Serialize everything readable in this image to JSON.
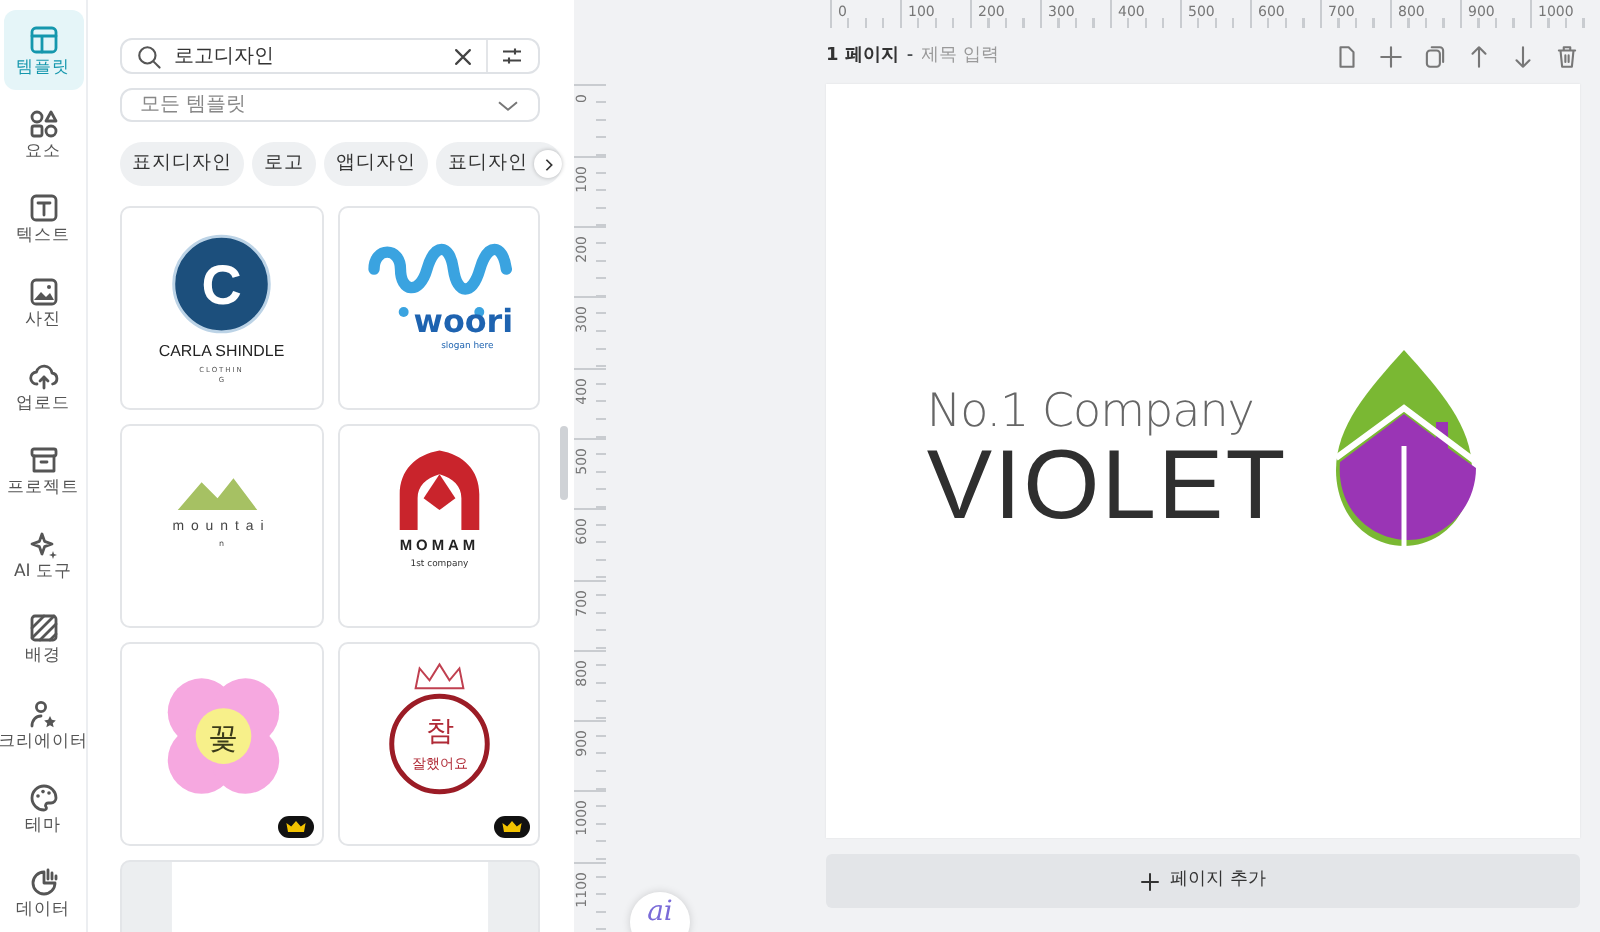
{
  "nav": [
    {
      "kind": "template",
      "label": "템플릿",
      "selected": true
    },
    {
      "kind": "elements",
      "label": "요소",
      "selected": false
    },
    {
      "kind": "text",
      "label": "텍스트",
      "selected": false
    },
    {
      "kind": "photo",
      "label": "사진",
      "selected": false
    },
    {
      "kind": "upload",
      "label": "업로드",
      "selected": false
    },
    {
      "kind": "project",
      "label": "프로젝트",
      "selected": false
    },
    {
      "kind": "sparkle",
      "label": "AI 도구",
      "selected": false
    },
    {
      "kind": "background",
      "label": "배경",
      "selected": false
    },
    {
      "kind": "creator",
      "label": "크리에이터",
      "selected": false
    },
    {
      "kind": "palette",
      "label": "테마",
      "selected": false
    },
    {
      "kind": "data",
      "label": "데이터",
      "selected": false
    }
  ],
  "search": {
    "value": "로고디자인"
  },
  "filter": {
    "value": "모든 템플릿"
  },
  "chips": [
    "표지디자인",
    "로고",
    "앱디자인",
    "표디자인"
  ],
  "templates": [
    {
      "kind": "monogram",
      "texts": [
        "C",
        "CARLA SHINDLE",
        "CLOTHIN",
        "G"
      ],
      "premium": false
    },
    {
      "kind": "wave",
      "texts": [
        "woori",
        "slogan here"
      ],
      "premium": false
    },
    {
      "kind": "mountain",
      "texts": [
        "mountai",
        "n"
      ],
      "premium": false
    },
    {
      "kind": "arch",
      "texts": [
        "MOMAM",
        "1st company"
      ],
      "premium": false
    },
    {
      "kind": "flower",
      "texts": [
        "꽃"
      ],
      "premium": true
    },
    {
      "kind": "stamp",
      "texts": [
        "참",
        "잘했어요"
      ],
      "premium": true
    },
    {
      "kind": "blank",
      "premium": false
    }
  ],
  "ruler_h": [
    "0",
    "100",
    "200",
    "300",
    "400",
    "500",
    "600",
    "700",
    "800",
    "900",
    "1000"
  ],
  "ruler_v": [
    "0",
    "100",
    "200",
    "300",
    "400",
    "500",
    "600",
    "700",
    "800",
    "900",
    "1000",
    "1100"
  ],
  "page": {
    "label": "1 페이지",
    "separator": "-",
    "title_placeholder": "제목 입력"
  },
  "design": {
    "tagline": "No.1 Company",
    "name": "VIOLET"
  },
  "add_page": "페이지 추가",
  "ai_button": "ai"
}
